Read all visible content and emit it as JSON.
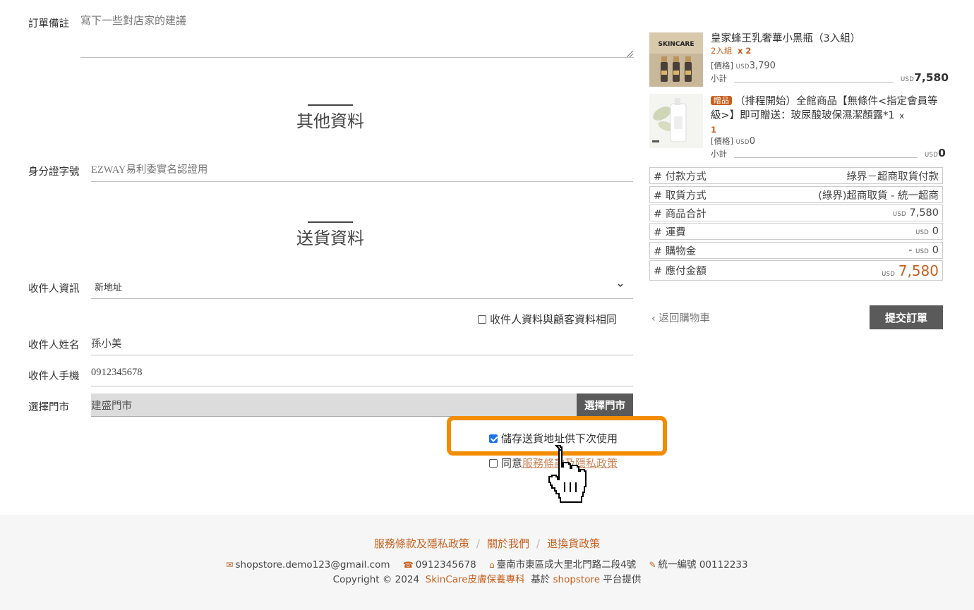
{
  "order_note": {
    "label": "訂單備註",
    "placeholder": "寫下一些對店家的建議"
  },
  "other_section": {
    "title": "其他資料",
    "id_label": "身分證字號",
    "id_placeholder": "EZWAY易利委實名認證用"
  },
  "shipping_section": {
    "title": "送貨資料",
    "recipient_info_label": "收件人資訊",
    "recipient_info_value": "新地址",
    "same_as_customer_label": "收件人資料與顧客資料相同",
    "name_label": "收件人姓名",
    "name_value": "孫小美",
    "phone_label": "收件人手機",
    "phone_value": "0912345678",
    "store_label": "選擇門市",
    "store_value": "建盛門市",
    "store_button": "選擇門市",
    "save_address_label": "儲存送貨地址供下次使用",
    "agree_prefix": "同意",
    "agree_link": "服務條款及隱私政策"
  },
  "cart": {
    "items": [
      {
        "image_label": "SKINCARE",
        "name": "皇家蜂王乳奢華小黑瓶（3入組）",
        "variant": "2入組",
        "qty": "x 2",
        "price_label": "[價格]",
        "currency": "USD",
        "price": "3,790",
        "subtotal_label": "小計",
        "subtotal": "7,580"
      },
      {
        "badge": "贈品",
        "name": "（排程開始）全館商品【無條件<指定會員等級>】即可贈送：玻尿酸玻保濕潔顏露*1",
        "qty_prefix": "x",
        "qty": "1",
        "price_label": "[價格]",
        "currency": "USD",
        "price": "0",
        "subtotal_label": "小計",
        "subtotal": "0"
      }
    ]
  },
  "summary": [
    {
      "label": "# 付款方式",
      "value": "綠界－超商取貨付款"
    },
    {
      "label": "# 取貨方式",
      "value": "(綠界)超商取貨 - 統一超商"
    },
    {
      "label": "# 商品合計",
      "currency": "USD",
      "value": "7,580"
    },
    {
      "label": "# 運費",
      "currency": "USD",
      "value": "0"
    },
    {
      "label": "# 購物金",
      "prefix": "-",
      "currency": "USD",
      "value": "0"
    },
    {
      "label": "# 應付金額",
      "currency": "USD",
      "value": "7,580"
    }
  ],
  "actions": {
    "back_label": "返回購物車",
    "submit_label": "提交訂單"
  },
  "footer": {
    "links": [
      "服務條款及隱私政策",
      "關於我們",
      "退換貨政策"
    ],
    "email": "shopstore.demo123@gmail.com",
    "phone": "0912345678",
    "address": "臺南市東區成大里北門路二段4號",
    "tax_id": "統一編號 00112233",
    "copyright": "Copyright © 2024",
    "brand": "SkinCare皮膚保養專科",
    "based_on": "基於",
    "platform": "shopstore",
    "provided": "平台提供"
  },
  "colors": {
    "accent": "#c8601e",
    "highlight": "#f28c00",
    "button_dark": "#5a5a5a"
  }
}
